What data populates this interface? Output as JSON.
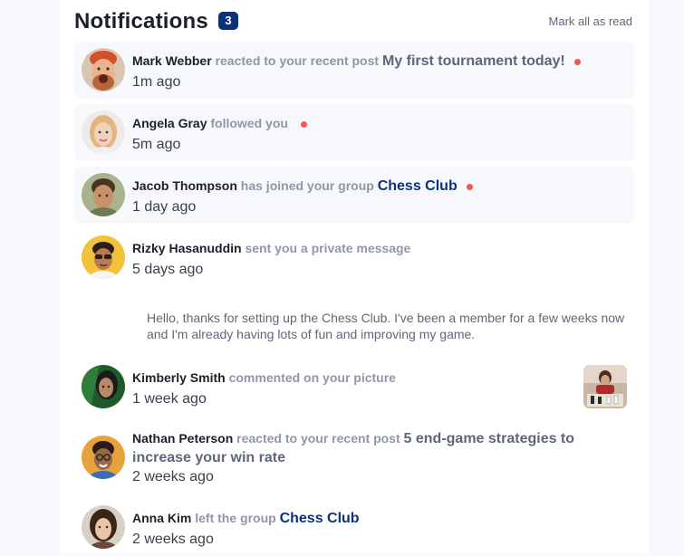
{
  "header": {
    "title": "Notifications",
    "count": "3",
    "mark_all": "Mark all as read"
  },
  "notifications": [
    {
      "name": "Mark Webber",
      "action": "reacted to your recent post",
      "target": "My first tournament today!",
      "time": "1m ago",
      "unread": true
    },
    {
      "name": "Angela Gray",
      "action": "followed you",
      "target": "",
      "time": "5m ago",
      "unread": true
    },
    {
      "name": "Jacob Thompson",
      "action": "has joined your group",
      "target": "Chess Club",
      "time": "1 day ago",
      "unread": true
    },
    {
      "name": "Rizky Hasanuddin",
      "action": "sent you a private message",
      "target": "",
      "time": "5 days ago",
      "unread": false,
      "message": "Hello, thanks for setting up the Chess Club. I've been a member for a few weeks now and I'm already having lots of fun and improving my game."
    },
    {
      "name": "Kimberly Smith",
      "action": "commented on your picture",
      "target": "",
      "time": "1 week ago",
      "unread": false
    },
    {
      "name": "Nathan Peterson",
      "action": "reacted to your recent post",
      "target": "5 end-game strategies to increase your win rate",
      "time": "2 weeks ago",
      "unread": false
    },
    {
      "name": "Anna Kim",
      "action": "left the group",
      "target": "Chess Club",
      "time": "2 weeks ago",
      "unread": false
    }
  ],
  "colors": {
    "accent": "#0a327b",
    "unread_dot": "#f65552",
    "unread_bg": "#f6f8fb",
    "muted": "#8f97a6"
  }
}
